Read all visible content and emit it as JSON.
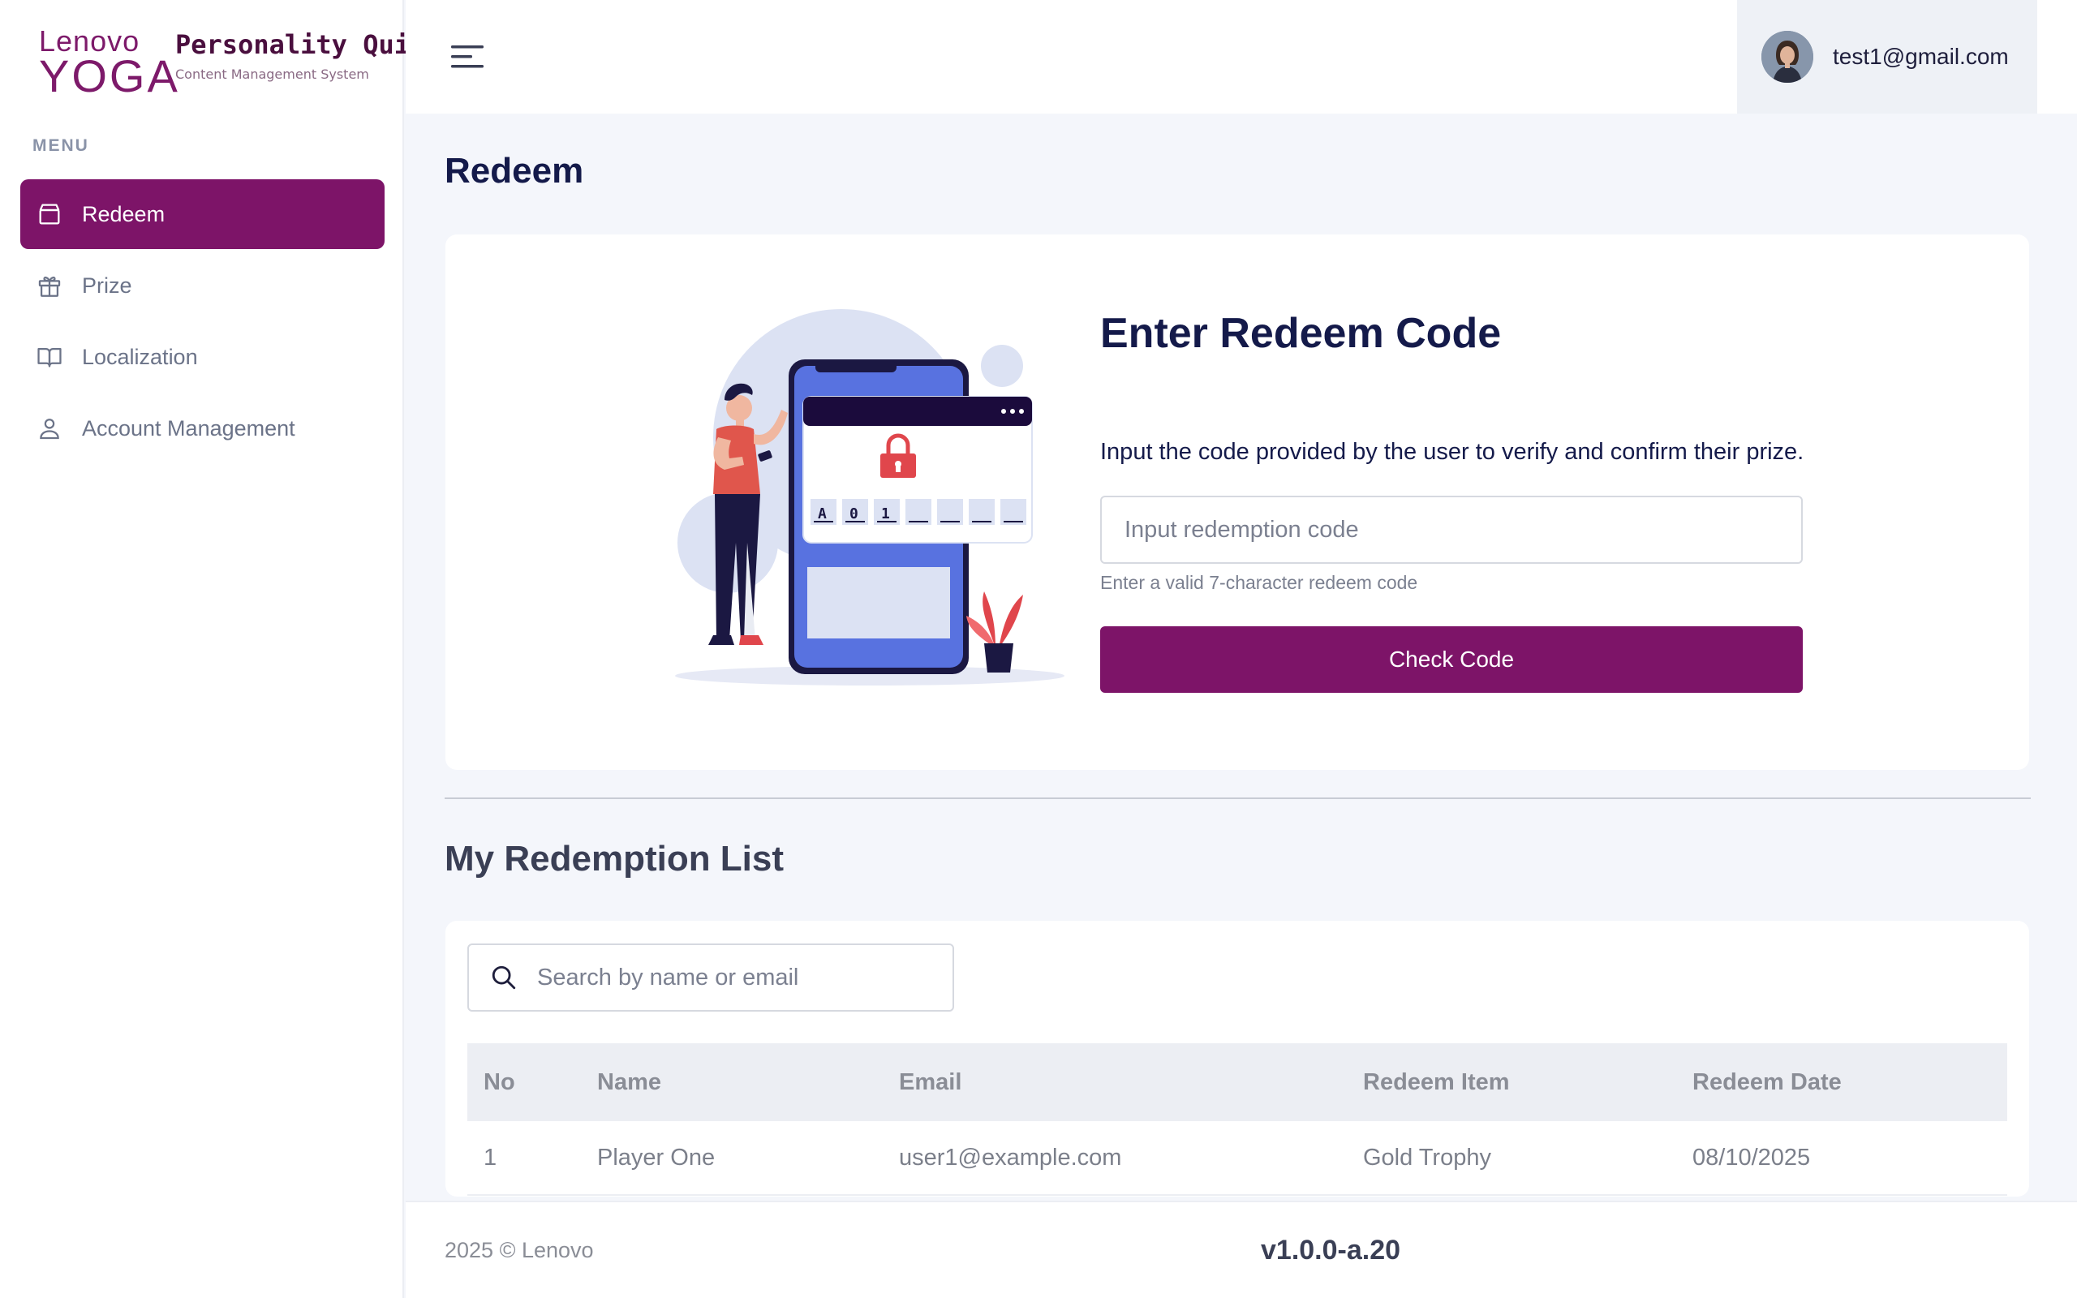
{
  "brand": {
    "logo_line1": "Lenovo",
    "logo_line2": "YOGA",
    "app_title": "Personality Quiz",
    "app_subtitle": "Content Management System",
    "accent_color": "#7d1468"
  },
  "sidebar": {
    "menu_heading": "MENU",
    "items": [
      {
        "label": "Redeem",
        "icon": "box-icon",
        "active": true
      },
      {
        "label": "Prize",
        "icon": "gift-icon",
        "active": false
      },
      {
        "label": "Localization",
        "icon": "book-icon",
        "active": false
      },
      {
        "label": "Account Management",
        "icon": "user-icon",
        "active": false
      }
    ]
  },
  "header": {
    "menu_toggle_icon": "hamburger-icon",
    "user_email": "test1@gmail.com"
  },
  "page": {
    "title": "Redeem"
  },
  "redeem": {
    "heading": "Enter Redeem Code",
    "description": "Input the code provided by the user to verify and confirm their prize.",
    "input_placeholder": "Input redemption code",
    "input_value": "",
    "hint": "Enter a valid 7-character redeem code",
    "button_label": "Check Code",
    "illustration_code_chars": [
      "A",
      "0",
      "1",
      "",
      "",
      "",
      ""
    ]
  },
  "redemption_list": {
    "title": "My Redemption List",
    "search_placeholder": "Search by name or email",
    "columns": [
      "No",
      "Name",
      "Email",
      "Redeem Item",
      "Redeem Date"
    ],
    "rows": [
      [
        "1",
        "Player One",
        "user1@example.com",
        "Gold Trophy",
        "08/10/2025"
      ]
    ]
  },
  "footer": {
    "copyright": "2025 © Lenovo",
    "version": "v1.0.0-a.20"
  }
}
